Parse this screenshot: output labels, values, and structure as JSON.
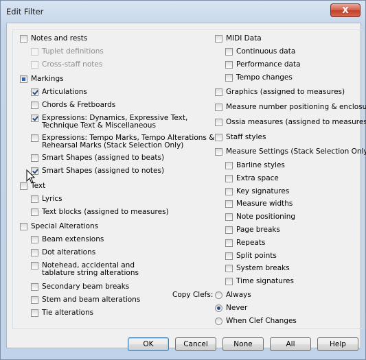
{
  "window": {
    "title": "Edit Filter",
    "close_symbol": "X"
  },
  "left": [
    {
      "label": "Notes and rests",
      "state": "unchecked"
    },
    {
      "label": "Tuplet definitions",
      "state": "disabled"
    },
    {
      "label": "Cross-staff notes",
      "state": "disabled"
    },
    {
      "label": "Markings",
      "state": "indeterminate"
    },
    {
      "label": "Articulations",
      "state": "checked"
    },
    {
      "label": "Chords & Fretboards",
      "state": "unchecked"
    },
    {
      "label": "Expressions: Dynamics, Expressive Text,",
      "label2": "Technique Text & Miscellaneous",
      "state": "checked"
    },
    {
      "label": "Expressions: Tempo Marks, Tempo Alterations &",
      "label2": "Rehearsal Marks (Stack Selection Only)",
      "state": "unchecked"
    },
    {
      "label": "Smart Shapes (assigned to beats)",
      "state": "unchecked"
    },
    {
      "label": "Smart Shapes (assigned to notes)",
      "state": "checked"
    },
    {
      "label": "Text",
      "state": "unchecked"
    },
    {
      "label": "Lyrics",
      "state": "unchecked"
    },
    {
      "label": "Text blocks (assigned to measures)",
      "state": "unchecked"
    },
    {
      "label": "Special Alterations",
      "state": "unchecked"
    },
    {
      "label": "Beam extensions",
      "state": "unchecked"
    },
    {
      "label": "Dot alterations",
      "state": "unchecked"
    },
    {
      "label": "Notehead, accidental and",
      "label2": "tablature string alterations",
      "state": "unchecked"
    },
    {
      "label": "Secondary beam breaks",
      "state": "unchecked"
    },
    {
      "label": "Stem and beam alterations",
      "state": "unchecked"
    },
    {
      "label": "Tie alterations",
      "state": "unchecked"
    }
  ],
  "right": [
    {
      "label": "MIDI Data",
      "state": "unchecked"
    },
    {
      "label": "Continuous data",
      "state": "unchecked"
    },
    {
      "label": "Performance data",
      "state": "unchecked"
    },
    {
      "label": "Tempo changes",
      "state": "unchecked"
    },
    {
      "label": "Graphics (assigned to measures)",
      "state": "unchecked"
    },
    {
      "label": "Measure number positioning & enclosures",
      "state": "unchecked"
    },
    {
      "label": "Ossia measures (assigned to measures)",
      "state": "unchecked"
    },
    {
      "label": "Staff styles",
      "state": "unchecked"
    },
    {
      "label": "Measure Settings (Stack Selection Only)",
      "state": "unchecked"
    },
    {
      "label": "Barline styles",
      "state": "unchecked"
    },
    {
      "label": "Extra space",
      "state": "unchecked"
    },
    {
      "label": "Key signatures",
      "state": "unchecked"
    },
    {
      "label": "Measure widths",
      "state": "unchecked"
    },
    {
      "label": "Note positioning",
      "state": "unchecked"
    },
    {
      "label": "Page breaks",
      "state": "unchecked"
    },
    {
      "label": "Repeats",
      "state": "unchecked"
    },
    {
      "label": "Split points",
      "state": "unchecked"
    },
    {
      "label": "System breaks",
      "state": "unchecked"
    },
    {
      "label": "Time signatures",
      "state": "unchecked"
    }
  ],
  "copy_clefs": {
    "label": "Copy Clefs:",
    "options": [
      {
        "label": "Always",
        "selected": false
      },
      {
        "label": "Never",
        "selected": true
      },
      {
        "label": "When Clef Changes",
        "selected": false
      }
    ]
  },
  "buttons": {
    "ok": "OK",
    "cancel": "Cancel",
    "none": "None",
    "all": "All",
    "help": "Help"
  }
}
